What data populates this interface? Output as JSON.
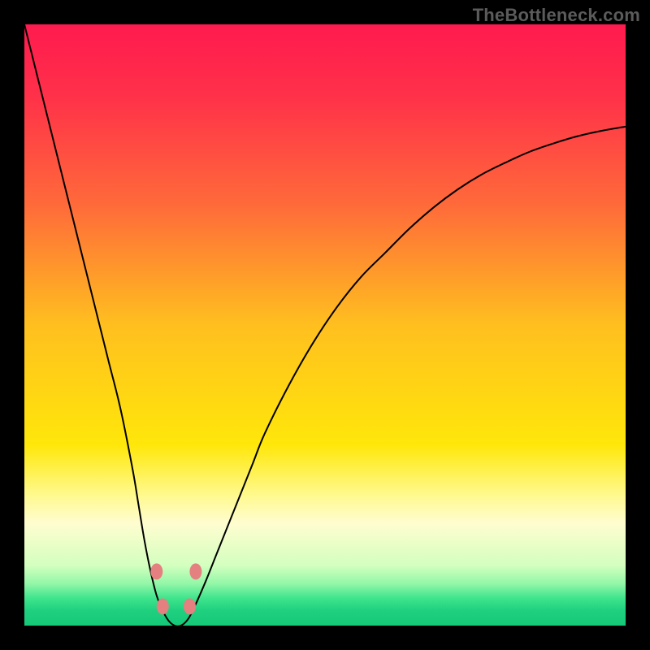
{
  "watermark": "TheBottleneck.com",
  "chart_data": {
    "type": "line",
    "title": "",
    "xlabel": "",
    "ylabel": "",
    "xlim": [
      0,
      100
    ],
    "ylim": [
      0,
      100
    ],
    "grid": false,
    "legend": false,
    "background": {
      "type": "vertical-gradient",
      "stops": [
        {
          "pos": 0.0,
          "color": "#ff1a4f"
        },
        {
          "pos": 0.12,
          "color": "#ff3149"
        },
        {
          "pos": 0.3,
          "color": "#ff6a3a"
        },
        {
          "pos": 0.5,
          "color": "#ffbf1f"
        },
        {
          "pos": 0.7,
          "color": "#ffe70a"
        },
        {
          "pos": 0.78,
          "color": "#fff98a"
        },
        {
          "pos": 0.83,
          "color": "#fffdd0"
        },
        {
          "pos": 0.9,
          "color": "#d3ffbf"
        },
        {
          "pos": 0.93,
          "color": "#93f7a8"
        },
        {
          "pos": 0.955,
          "color": "#3de48c"
        },
        {
          "pos": 0.975,
          "color": "#1fd07f"
        },
        {
          "pos": 1.0,
          "color": "#14c979"
        }
      ]
    },
    "series": [
      {
        "name": "bottleneck-curve",
        "stroke": "#000000",
        "stroke_width": 2,
        "x": [
          0,
          2,
          4,
          6,
          8,
          10,
          12,
          14,
          16,
          18,
          19,
          20,
          21,
          22,
          23,
          24,
          25,
          26,
          27,
          28,
          30,
          32,
          34,
          36,
          38,
          40,
          44,
          48,
          52,
          56,
          60,
          64,
          68,
          72,
          76,
          80,
          84,
          88,
          92,
          96,
          100
        ],
        "y": [
          100,
          92,
          84,
          76,
          68,
          60,
          52,
          44,
          36,
          26,
          20,
          14,
          9,
          5,
          2.5,
          0.8,
          0,
          0,
          0.8,
          2.5,
          7,
          12,
          17,
          22,
          27,
          32,
          40,
          47,
          53,
          58,
          62,
          66,
          69.5,
          72.5,
          75,
          77,
          78.8,
          80.2,
          81.4,
          82.3,
          83
        ]
      }
    ],
    "markers": [
      {
        "name": "marker",
        "x": 22.0,
        "y": 9.0,
        "color": "#e58080",
        "r": 10
      },
      {
        "name": "marker",
        "x": 28.5,
        "y": 9.0,
        "color": "#e58080",
        "r": 10
      },
      {
        "name": "marker",
        "x": 23.0,
        "y": 3.2,
        "color": "#e58080",
        "r": 10
      },
      {
        "name": "marker",
        "x": 27.5,
        "y": 3.2,
        "color": "#e58080",
        "r": 10
      }
    ]
  }
}
